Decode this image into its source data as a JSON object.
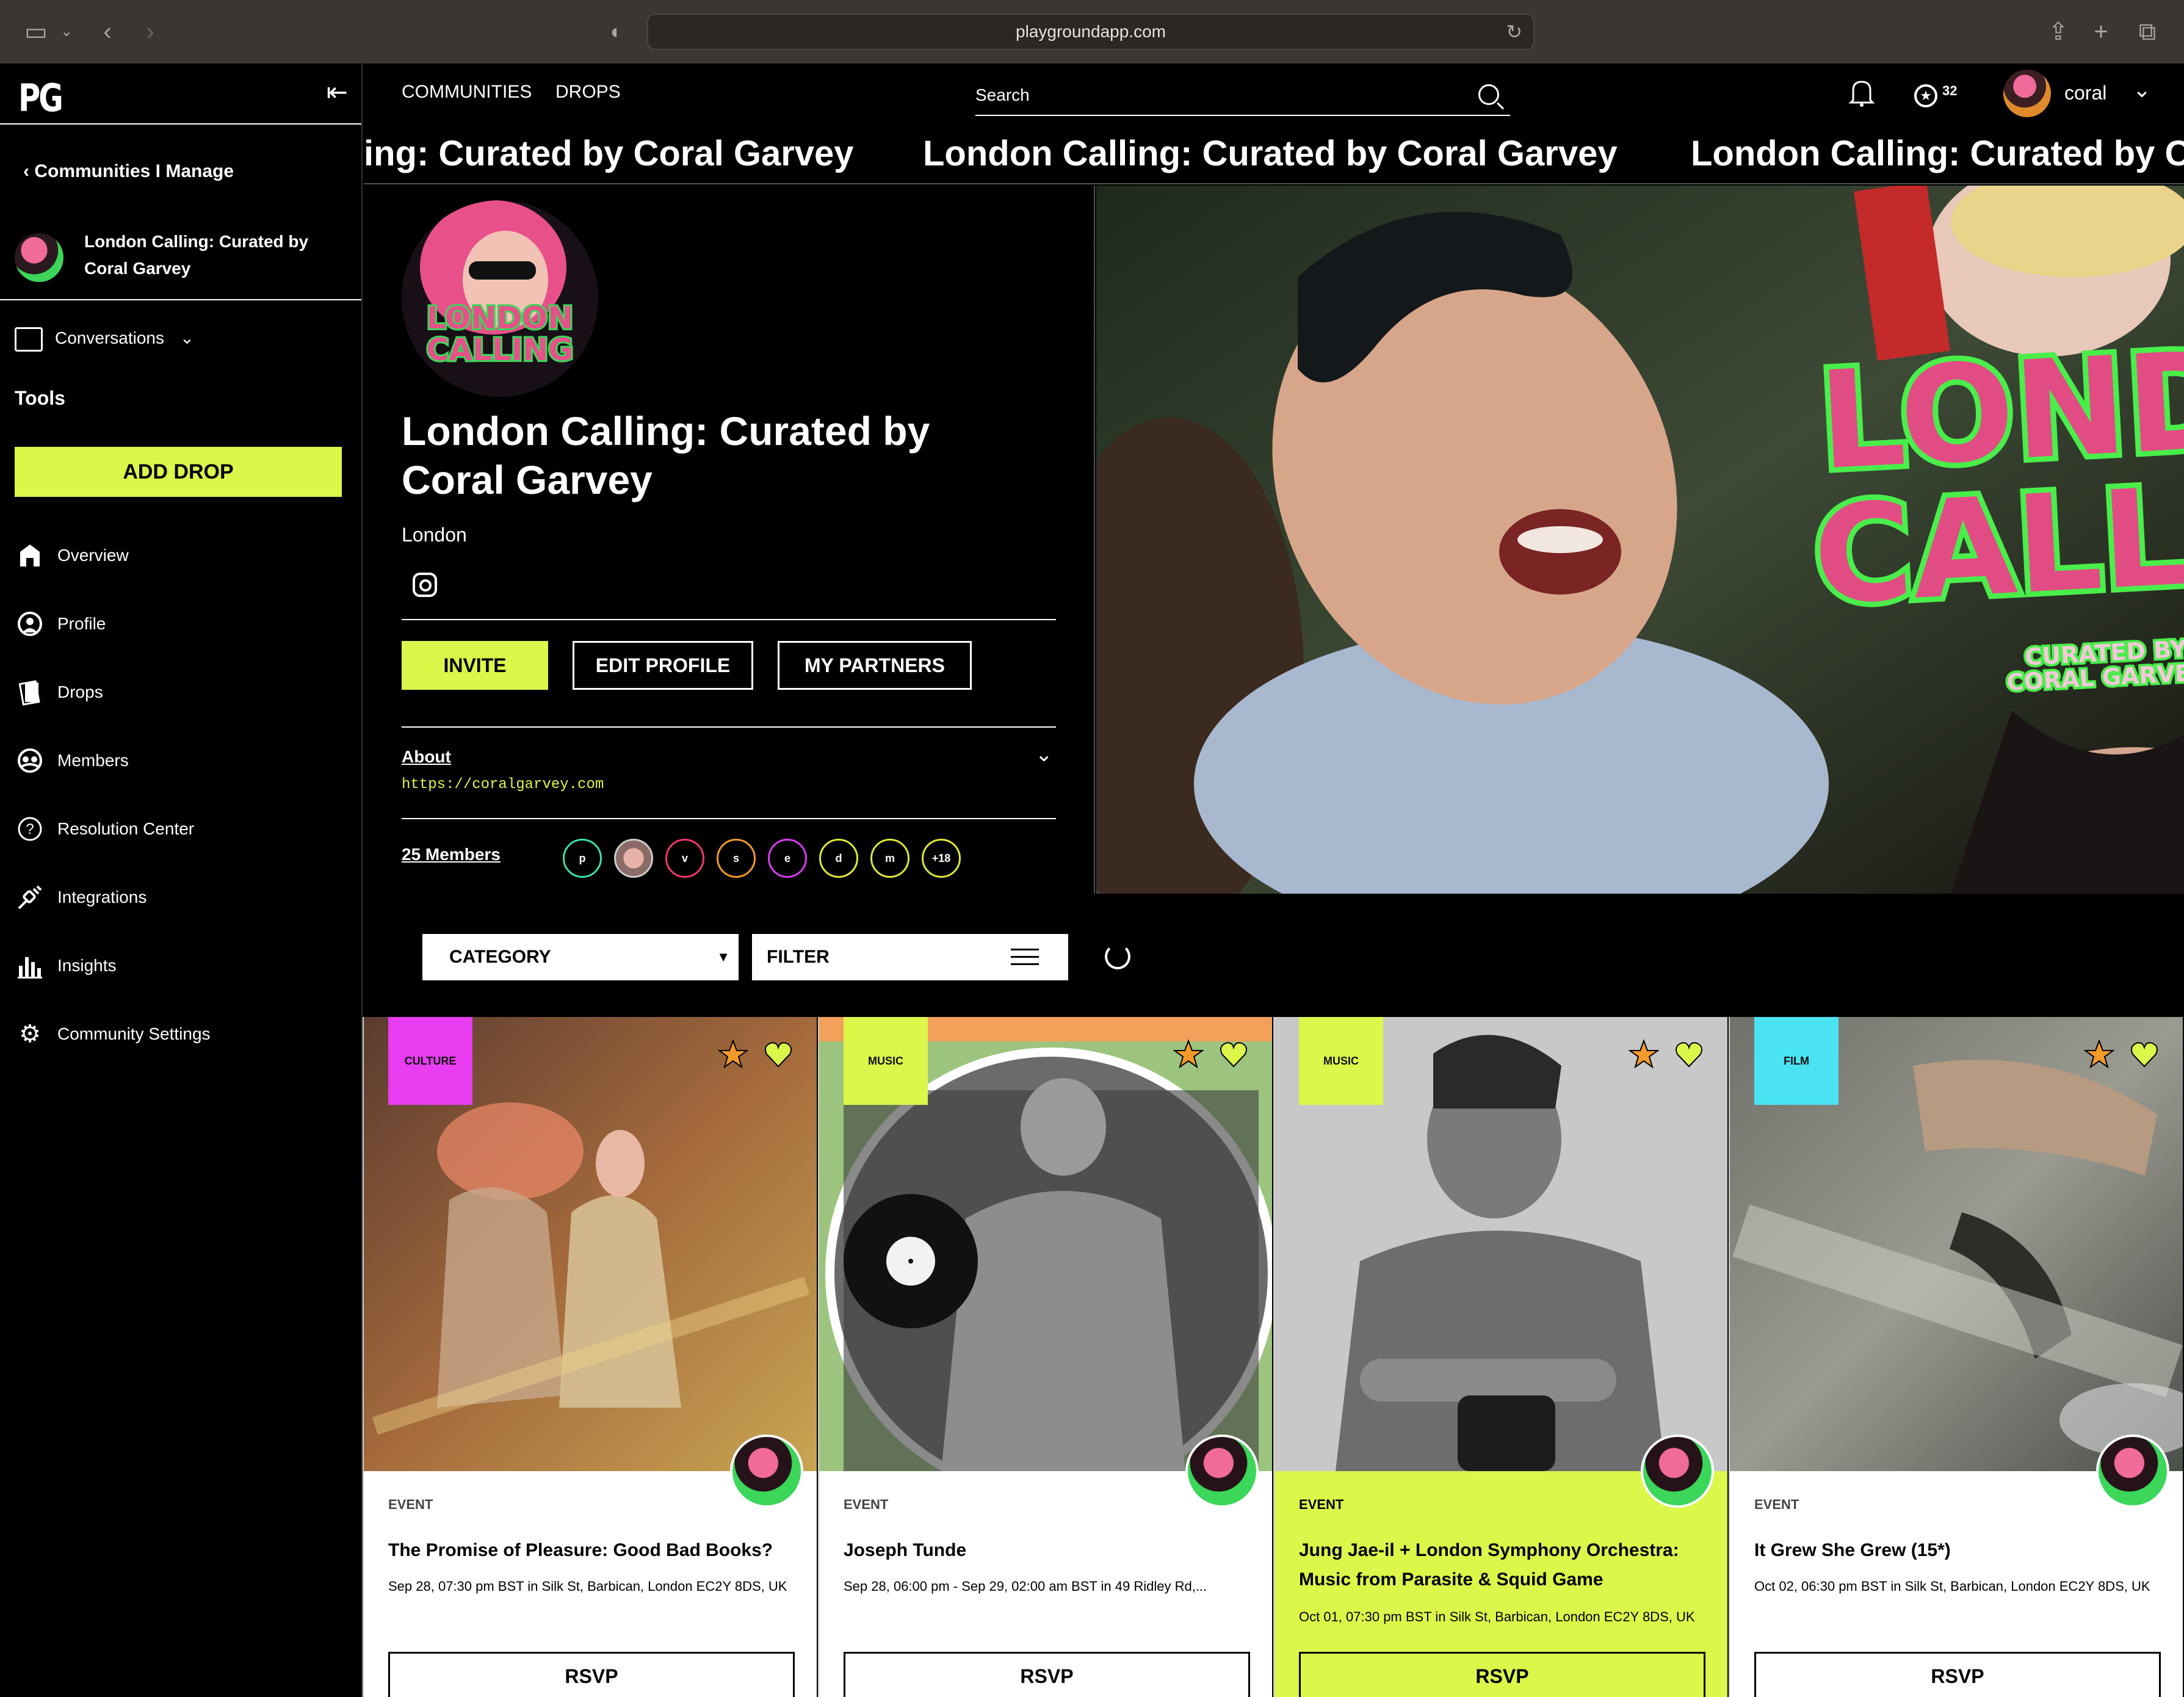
{
  "browser": {
    "url": "playgroundapp.com"
  },
  "sidebar": {
    "logo": "PG",
    "back_label": "Communities I Manage",
    "community_name": "London Calling: Curated by Coral Garvey",
    "conversations": "Conversations",
    "tools_heading": "Tools",
    "add_drop": "ADD DROP",
    "items": [
      {
        "label": "Overview",
        "icon": "home-icon"
      },
      {
        "label": "Profile",
        "icon": "profile-icon"
      },
      {
        "label": "Drops",
        "icon": "drops-icon"
      },
      {
        "label": "Members",
        "icon": "members-icon"
      },
      {
        "label": "Resolution Center",
        "icon": "question-icon"
      },
      {
        "label": "Integrations",
        "icon": "plug-icon"
      },
      {
        "label": "Insights",
        "icon": "chart-icon"
      },
      {
        "label": "Community Settings",
        "icon": "gear-icon"
      }
    ]
  },
  "topnav": {
    "communities": "COMMUNITIES",
    "drops": "DROPS",
    "search_placeholder": "Search",
    "points": "32",
    "username": "coral"
  },
  "marquee": {
    "text_1": "ing: Curated by Coral Garvey",
    "text_2": "London Calling: Curated by Coral Garvey",
    "text_3": "London Calling: Curated by C"
  },
  "profile": {
    "title": "London Calling: Curated by Coral Garvey",
    "location": "London",
    "invite": "INVITE",
    "edit_profile": "EDIT PROFILE",
    "my_partners": "MY PARTNERS",
    "about_label": "About",
    "about_url": "https://coralgarvey.com",
    "members_label": "25 Members",
    "member_initials": [
      "p",
      "",
      "v",
      "s",
      "e",
      "d",
      "m",
      "+18"
    ],
    "avatar_text_1": "LONDON",
    "avatar_text_2": "CALLING"
  },
  "banner": {
    "line1": "LONDON",
    "line2": "CALLING",
    "sub1": "CURATED BY",
    "sub2": "CORAL GARVEY"
  },
  "filters": {
    "category": "CATEGORY",
    "filter": "FILTER"
  },
  "cards": [
    {
      "badge": "CULTURE",
      "type": "EVENT",
      "title": "The Promise of Pleasure: Good Bad Books?",
      "meta": "Sep 28, 07:30 pm BST in Silk St, Barbican, London EC2Y 8DS, UK",
      "rsvp": "RSVP"
    },
    {
      "badge": "MUSIC",
      "type": "EVENT",
      "title": "Joseph Tunde",
      "meta": "Sep 28, 06:00 pm - Sep 29, 02:00 am BST in 49 Ridley Rd,...",
      "rsvp": "RSVP"
    },
    {
      "badge": "MUSIC",
      "type": "EVENT",
      "title": "Jung Jae-il + London Symphony Orchestra: Music from Parasite & Squid Game",
      "meta": "Oct 01, 07:30 pm BST in Silk St, Barbican, London EC2Y 8DS, UK",
      "rsvp": "RSVP"
    },
    {
      "badge": "FILM",
      "type": "EVENT",
      "title": "It Grew She Grew (15*)",
      "meta": "Oct 02, 06:30 pm BST in Silk St, Barbican, London EC2Y 8DS, UK",
      "rsvp": "RSVP"
    }
  ],
  "colors": {
    "accent": "#dcf64a",
    "culture": "#e83df0",
    "music": "#dcf64a",
    "film": "#4be3f2"
  }
}
